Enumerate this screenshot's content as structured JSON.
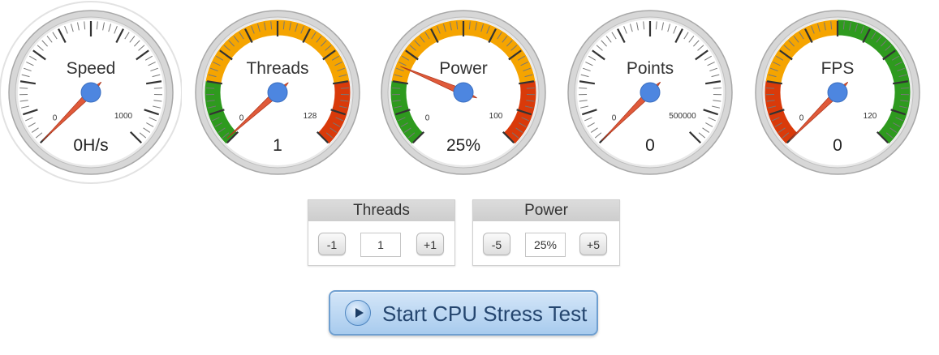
{
  "gauges": [
    {
      "id": "speed",
      "title": "Speed",
      "min_label": "0",
      "max_label": "1000",
      "value_label": "0H/s",
      "needle_fraction": 0.0,
      "bands": []
    },
    {
      "id": "threads",
      "title": "Threads",
      "min_label": "0",
      "max_label": "128",
      "value_label": "1",
      "needle_fraction": 0.01,
      "bands": [
        {
          "from": 0.0,
          "to": 0.2,
          "color": "#2e9a1e"
        },
        {
          "from": 0.2,
          "to": 0.8,
          "color": "#f5a400"
        },
        {
          "from": 0.8,
          "to": 1.0,
          "color": "#d93a0a"
        }
      ]
    },
    {
      "id": "power",
      "title": "Power",
      "min_label": "0",
      "max_label": "100",
      "value_label": "25%",
      "needle_fraction": 0.25,
      "bands": [
        {
          "from": 0.0,
          "to": 0.2,
          "color": "#2e9a1e"
        },
        {
          "from": 0.2,
          "to": 0.8,
          "color": "#f5a400"
        },
        {
          "from": 0.8,
          "to": 1.0,
          "color": "#d93a0a"
        }
      ]
    },
    {
      "id": "points",
      "title": "Points",
      "min_label": "0",
      "max_label": "500000",
      "value_label": "0",
      "needle_fraction": 0.0,
      "bands": []
    },
    {
      "id": "fps",
      "title": "FPS",
      "min_label": "0",
      "max_label": "120",
      "value_label": "0",
      "needle_fraction": 0.0,
      "bands": [
        {
          "from": 0.0,
          "to": 0.2,
          "color": "#d93a0a"
        },
        {
          "from": 0.2,
          "to": 0.5,
          "color": "#f5a400"
        },
        {
          "from": 0.5,
          "to": 1.0,
          "color": "#2e9a1e"
        }
      ]
    }
  ],
  "controls": {
    "threads": {
      "title": "Threads",
      "dec_label": "-1",
      "value": "1",
      "inc_label": "+1"
    },
    "power": {
      "title": "Power",
      "dec_label": "-5",
      "value": "25%",
      "inc_label": "+5"
    }
  },
  "start_button": {
    "label": "Start CPU Stress Test",
    "icon": "play-icon"
  },
  "colors": {
    "needle": "#e05a3a",
    "hub": "#4d86e0",
    "face": "#ffffff",
    "accent": "#a8cbee"
  }
}
